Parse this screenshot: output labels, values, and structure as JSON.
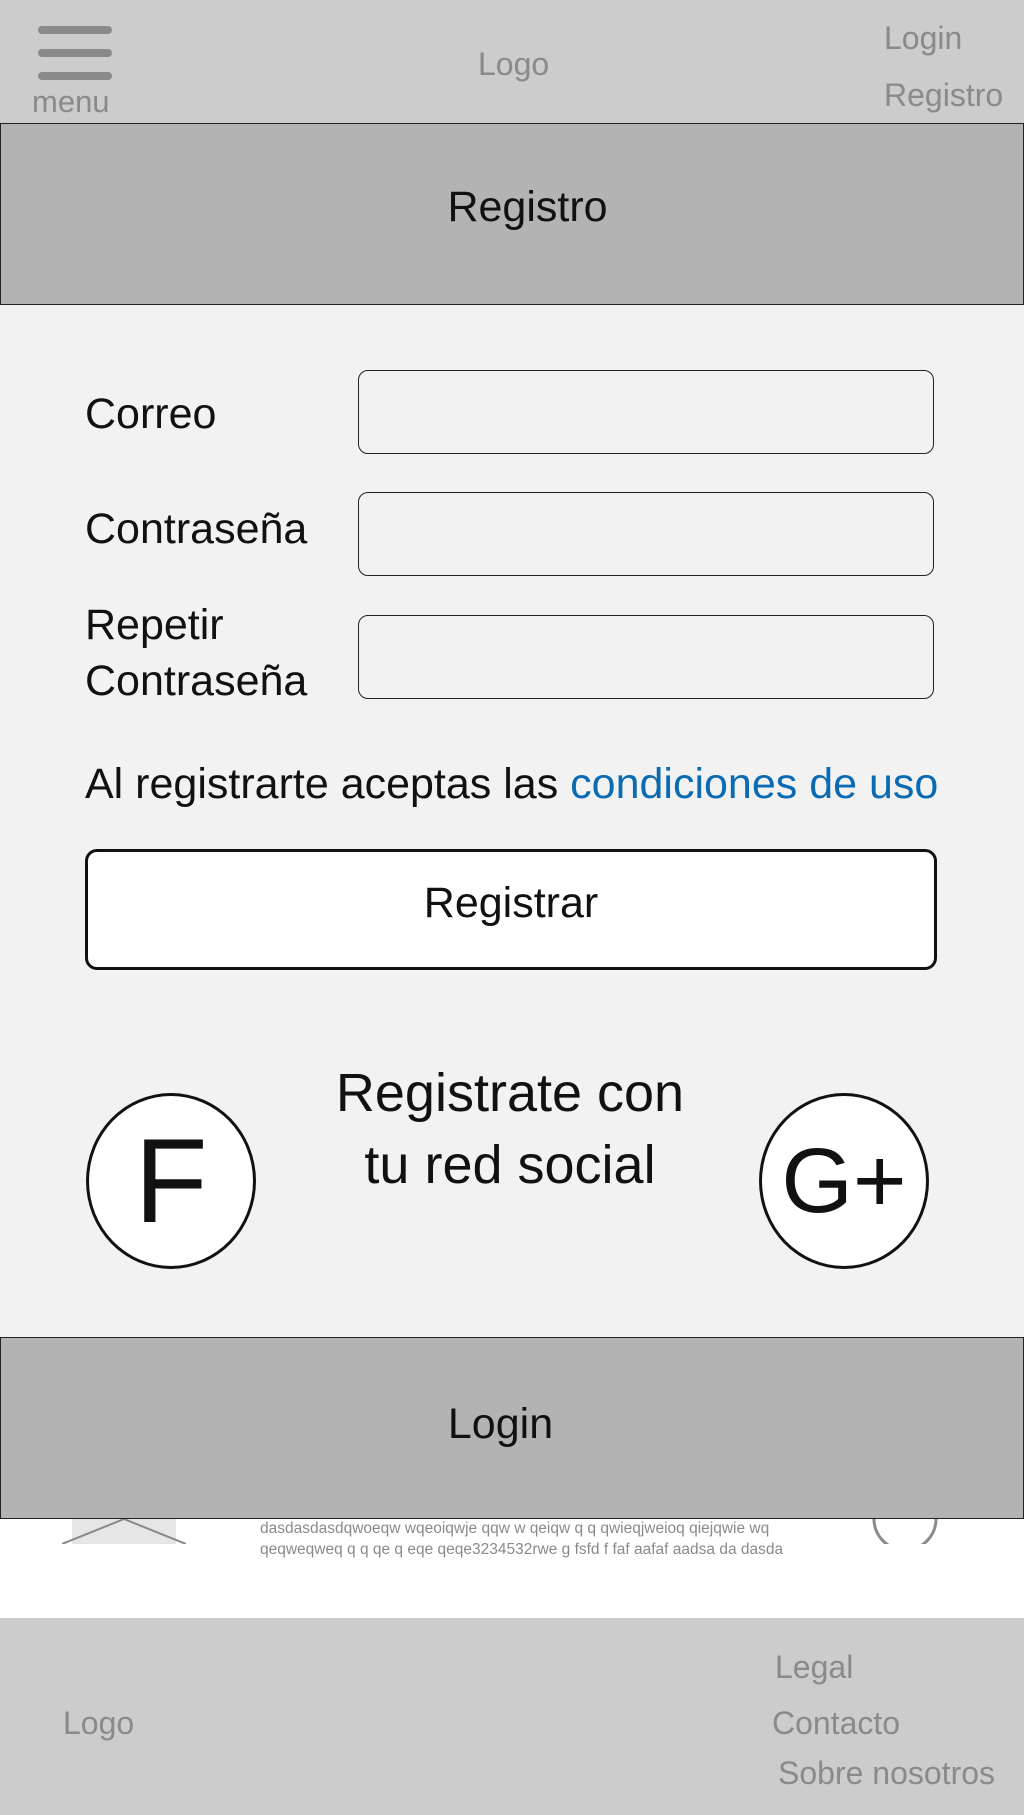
{
  "header": {
    "menu_label": "menu",
    "logo": "Logo",
    "login_link": "Login",
    "registro_link": "Registro"
  },
  "registro_banner": {
    "title": "Registro"
  },
  "form": {
    "fields": [
      {
        "label": "Correo",
        "value": ""
      },
      {
        "label": "Contraseña",
        "value": ""
      },
      {
        "label_line1": "Repetir",
        "label_line2": "Contraseña",
        "value": ""
      }
    ],
    "terms_text": "Al registrarte aceptas las ",
    "terms_link": "condiciones de uso",
    "register_button": "Registrar"
  },
  "social": {
    "line1": "Registrate con",
    "line2": "tu red social",
    "facebook_glyph": "F",
    "google_glyph": "G+"
  },
  "login_banner": {
    "title": "Login"
  },
  "peek_content": {
    "line1": "dasdasdasdqwoeqw wqeoiqwje qqw  w qeiqw  q  q qwieqjweioq qiejqwie wq",
    "line2": "qeqweqweq q  q qe q eqe qeqe3234532rwe g fsfd f faf aafaf aadsa da dasda"
  },
  "footer": {
    "logo": "Logo",
    "legal": "Legal",
    "contacto": "Contacto",
    "sobre_nosotros": "Sobre nosotros"
  },
  "colors": {
    "header_bg": "#cccccc",
    "banner_bg": "#b3b3b3",
    "form_bg": "#f2f2f2",
    "link": "#0a6bb3",
    "muted_text": "#8a8a8a"
  },
  "icons": {
    "menu": "hamburger-icon",
    "thumbnail": "image-placeholder-icon",
    "peek_circle": "circle-icon"
  }
}
